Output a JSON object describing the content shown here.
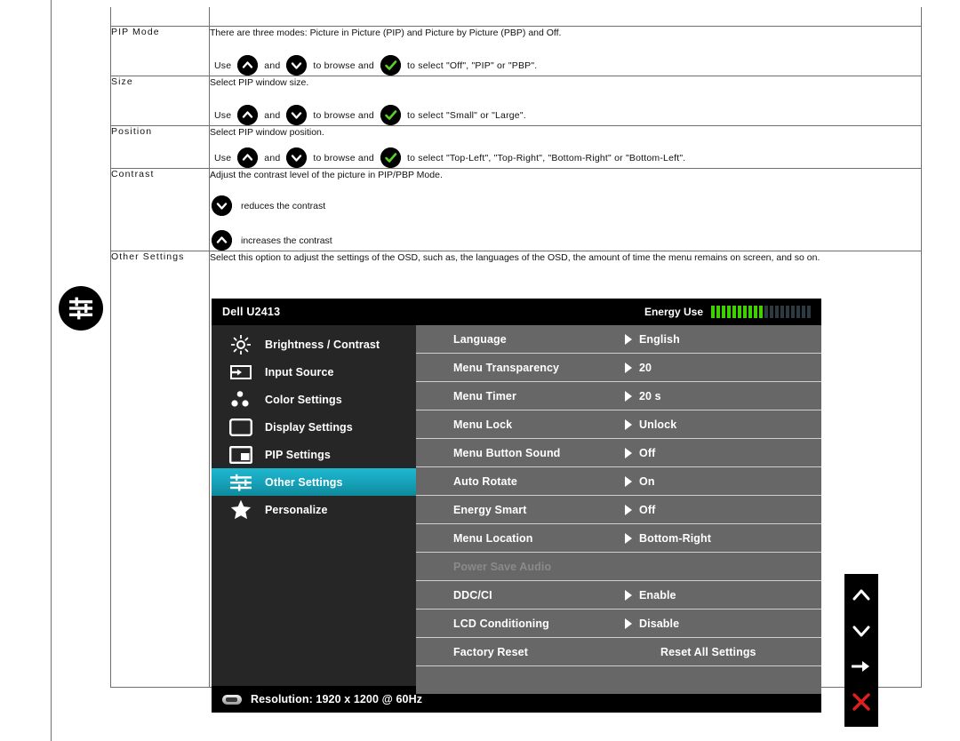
{
  "table": {
    "rows": [
      {
        "label": "PIP Mode",
        "desc": "There are three modes: Picture in Picture (PIP) and Picture by Picture (PBP) and Off.",
        "instruction": {
          "use": "Use",
          "and": "and",
          "to_browse": "to browse and",
          "to_select": "to select \"Off\", \"PIP\" or \"PBP\"."
        }
      },
      {
        "label": "Size",
        "desc": "Select PIP window size.",
        "instruction": {
          "use": "Use",
          "and": "and",
          "to_browse": "to browse and",
          "to_select": "to select \"Small\" or \"Large\"."
        }
      },
      {
        "label": "Position",
        "desc": "Select PIP window position.",
        "instruction": {
          "use": "Use",
          "and": "and",
          "to_browse": "to browse and",
          "to_select": "to select \"Top-Left\", \"Top-Right\", \"Bottom-Right\" or \"Bottom-Left\"."
        }
      },
      {
        "label": "Contrast",
        "desc": "Adjust the contrast level of the picture in PIP/PBP Mode.",
        "down_text": "reduces the contrast",
        "up_text": "increases the contrast"
      },
      {
        "label": "Other Settings",
        "desc": "Select this option to adjust the settings of the OSD, such as, the languages of the OSD, the amount of time the menu remains on screen, and so on."
      }
    ]
  },
  "left_icon": "sliders-icon",
  "osd": {
    "title": "Dell U2413",
    "energy": {
      "label": "Energy Use",
      "bars_on": 10,
      "bars_off": 9,
      "color_on": "#3fd000",
      "color_off": "#2e3a42"
    },
    "sidebar": [
      {
        "label": "Brightness / Contrast",
        "icon": "brightness-icon",
        "active": false
      },
      {
        "label": "Input Source",
        "icon": "input-source-icon",
        "active": false
      },
      {
        "label": "Color Settings",
        "icon": "color-settings-icon",
        "active": false
      },
      {
        "label": "Display Settings",
        "icon": "display-settings-icon",
        "active": false
      },
      {
        "label": "PIP Settings",
        "icon": "pip-settings-icon",
        "active": false
      },
      {
        "label": "Other Settings",
        "icon": "other-settings-icon",
        "active": true
      },
      {
        "label": "Personalize",
        "icon": "star-icon",
        "active": false
      }
    ],
    "accent_color": "#17a5bd",
    "rows": [
      {
        "label": "Language",
        "value": "English",
        "arrow": true,
        "disabled": false
      },
      {
        "label": "Menu Transparency",
        "value": "20",
        "arrow": true,
        "disabled": false
      },
      {
        "label": "Menu Timer",
        "value": "20 s",
        "arrow": true,
        "disabled": false
      },
      {
        "label": "Menu Lock",
        "value": "Unlock",
        "arrow": true,
        "disabled": false
      },
      {
        "label": "Menu Button Sound",
        "value": "Off",
        "arrow": true,
        "disabled": false
      },
      {
        "label": "Auto Rotate",
        "value": "On",
        "arrow": true,
        "disabled": false
      },
      {
        "label": "Energy Smart",
        "value": "Off",
        "arrow": true,
        "disabled": false
      },
      {
        "label": "Menu Location",
        "value": "Bottom-Right",
        "arrow": true,
        "disabled": false
      },
      {
        "label": "Power Save Audio",
        "value": "",
        "arrow": false,
        "disabled": true
      },
      {
        "label": "DDC/CI",
        "value": "Enable",
        "arrow": true,
        "disabled": false
      },
      {
        "label": "LCD Conditioning",
        "value": "Disable",
        "arrow": true,
        "disabled": false
      },
      {
        "label": "Factory Reset",
        "value": "Reset All Settings",
        "arrow": false,
        "disabled": false
      },
      {
        "label": "",
        "value": "",
        "arrow": false,
        "disabled": false
      }
    ],
    "footer": {
      "resolution": "Resolution: 1920 x 1200 @ 60Hz"
    }
  },
  "hw_buttons": [
    {
      "name": "up-button",
      "glyph": "chevron-up-icon",
      "color": "#ffffff"
    },
    {
      "name": "down-button",
      "glyph": "chevron-down-icon",
      "color": "#ffffff"
    },
    {
      "name": "ok-button",
      "glyph": "arrow-right-icon",
      "color": "#ffffff"
    },
    {
      "name": "close-button",
      "glyph": "close-x-icon",
      "color": "#e02020"
    }
  ]
}
